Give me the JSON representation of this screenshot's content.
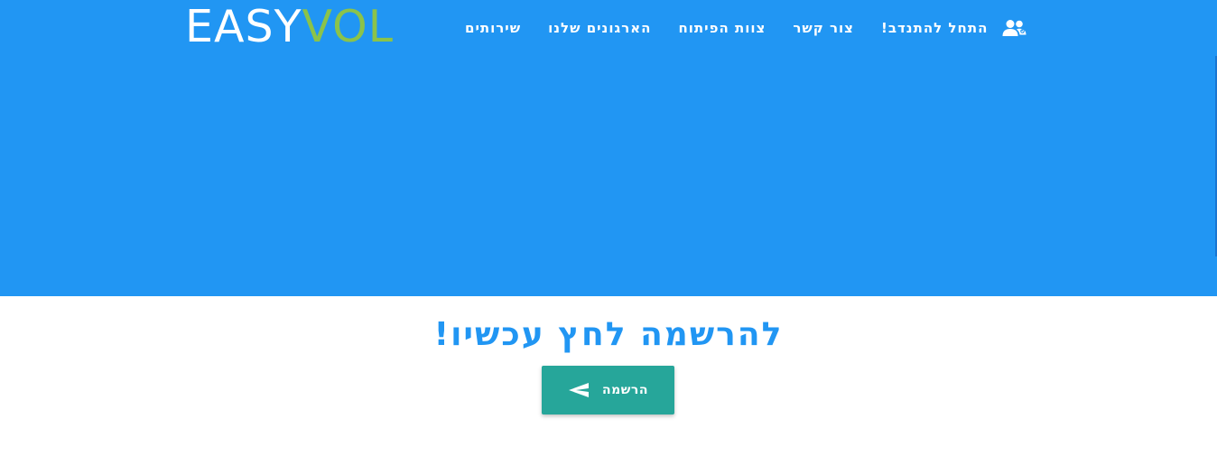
{
  "header": {
    "logo": {
      "part1": "EASY",
      "part2": "VOL"
    },
    "nav_icon": "users-icon",
    "nav_items": [
      {
        "label": "התחל להתנדב!"
      },
      {
        "label": "צור קשר"
      },
      {
        "label": "צוות הפיתוח"
      },
      {
        "label": "הארגונים שלנו"
      },
      {
        "label": "שירותים"
      }
    ]
  },
  "cta": {
    "title": "להרשמה לחץ עכשיו!",
    "button_label": "הרשמה",
    "button_icon": "send-icon"
  },
  "colors": {
    "primary": "#2196f3",
    "logo_accent": "#8bc34a",
    "button": "#26a69a"
  }
}
